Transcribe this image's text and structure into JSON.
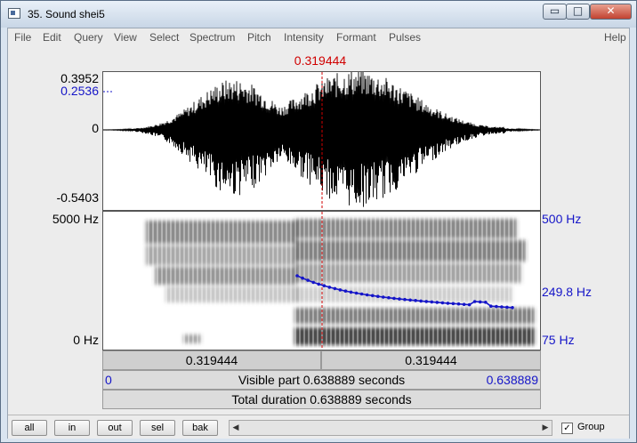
{
  "window": {
    "title": "35. Sound shei5",
    "min_glyph": "▭",
    "max_glyph": "□",
    "close_glyph": "✕"
  },
  "menu": {
    "items": [
      "File",
      "Edit",
      "Query",
      "View",
      "Select",
      "Spectrum",
      "Pitch",
      "Intensity",
      "Formant",
      "Pulses"
    ],
    "help": "Help"
  },
  "cursor": {
    "time": "0.319444"
  },
  "waveform": {
    "max_label": "0.3952",
    "cursor_value_label": "0.2536",
    "zero_label": "0",
    "min_label": "-0.5403"
  },
  "spectrogram": {
    "top_label": "5000 Hz",
    "bottom_label": "0 Hz"
  },
  "pitch": {
    "top_label": "500 Hz",
    "mid_label": "249.8 Hz",
    "bottom_label": "75 Hz"
  },
  "time_bars": {
    "left_segment": "0.319444",
    "right_segment": "0.319444",
    "visible_start": "0",
    "visible_part": "Visible part 0.638889 seconds",
    "visible_end": "0.638889",
    "total_duration": "Total duration 0.638889 seconds"
  },
  "buttons": {
    "all": "all",
    "in": "in",
    "out": "out",
    "sel": "sel",
    "bak": "bak"
  },
  "group": {
    "label": "Group",
    "checked": true,
    "check_glyph": "✓"
  },
  "scrollbar": {
    "left_arrow": "◀",
    "right_arrow": "▶"
  },
  "colors": {
    "cursor": "#d00000",
    "pitch": "#1515c8",
    "waveform": "#000000"
  }
}
